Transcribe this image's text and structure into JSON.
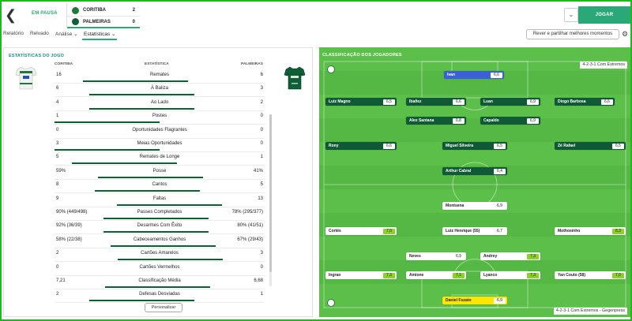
{
  "topbar": {
    "status": "EM PAUSA",
    "home": {
      "name": "CORITIBA",
      "goals": "2"
    },
    "away": {
      "name": "PALMEIRAS",
      "goals": "0"
    },
    "play_label": "JOGAR",
    "dropdown_icon": "chevron-down-icon"
  },
  "nav": {
    "items": [
      "Relatório",
      "Relvado",
      "Análise ⌄",
      "Estatísticas ⌄"
    ],
    "active_index": 3,
    "share_label": "Rever e partilhar melhores momentos",
    "settings_icon": "gear-icon"
  },
  "stats": {
    "title": "ESTATÍSTICAS DO JOGO",
    "col_home": "CORITIBA",
    "col_stat": "ESTATÍSTICA",
    "col_away": "PALMEIRAS",
    "personalize_label": "Personalizar",
    "bar_color": "#0e5e36",
    "rows": [
      {
        "home": "16",
        "name": "Remates",
        "away": "6",
        "hv": 16,
        "av": 6
      },
      {
        "home": "6",
        "name": "À Baliza",
        "away": "3",
        "hv": 6,
        "av": 3
      },
      {
        "home": "4",
        "name": "Ao Lado",
        "away": "2",
        "hv": 4,
        "av": 2
      },
      {
        "home": "1",
        "name": "Postes",
        "away": "0",
        "hv": 1,
        "av": 0
      },
      {
        "home": "0",
        "name": "Oportunidades Flagrantes",
        "away": "0",
        "hv": 0,
        "av": 0
      },
      {
        "home": "3",
        "name": "Meias Oportunidades",
        "away": "0",
        "hv": 3,
        "av": 0
      },
      {
        "home": "5",
        "name": "Remates de Longe",
        "away": "1",
        "hv": 5,
        "av": 1
      },
      {
        "home": "59%",
        "name": "Posse",
        "away": "41%",
        "hv": 59,
        "av": 41
      },
      {
        "home": "8",
        "name": "Cantos",
        "away": "5",
        "hv": 8,
        "av": 5
      },
      {
        "home": "9",
        "name": "Faltas",
        "away": "13",
        "hv": 9,
        "av": 13
      },
      {
        "home": "90% (449/498)",
        "name": "Passes Completados",
        "away": "78% (295/377)",
        "hv": 90,
        "av": 78
      },
      {
        "home": "92% (36/39)",
        "name": "Desarmes Com Êxito",
        "away": "80% (41/51)",
        "hv": 92,
        "av": 80
      },
      {
        "home": "58% (22/38)",
        "name": "Cabeceamentos Ganhos",
        "away": "67% (29/43)",
        "hv": 58,
        "av": 67
      },
      {
        "home": "2",
        "name": "Cartões Amarelos",
        "away": "3",
        "hv": 2,
        "av": 3
      },
      {
        "home": "0",
        "name": "Cartões Vermelhos",
        "away": "0",
        "hv": 0,
        "av": 0
      },
      {
        "home": "7,21",
        "name": "Classificação Média",
        "away": "6,68",
        "hv": 7.21,
        "av": 6.68
      },
      {
        "home": "2",
        "name": "Defesas Desviadas",
        "away": "1",
        "hv": 2,
        "av": 1
      }
    ]
  },
  "pitch": {
    "title": "CLASSIFICAÇÃO DOS JOGADORES",
    "formation_top": "4-2-3-1 Com Extremos",
    "formation_bottom": "4-2-3-1 Com Extremos - Gegenpress",
    "home_players": [
      {
        "name": "Ivan",
        "rating": "6,6",
        "gk": true
      },
      {
        "name": "Luiz Magno",
        "rating": "6,5"
      },
      {
        "name": "Ibañez",
        "rating": "6,6"
      },
      {
        "name": "Luan",
        "rating": "6,9"
      },
      {
        "name": "Diogo Barbosa",
        "rating": "6,6"
      },
      {
        "name": "Alex Santana",
        "rating": "6,8"
      },
      {
        "name": "Capaldo",
        "rating": "6,9"
      },
      {
        "name": "Rony",
        "rating": "6,6"
      },
      {
        "name": "Miguel Silveira",
        "rating": "6,5"
      },
      {
        "name": "Zé Rafael",
        "rating": "6,5"
      },
      {
        "name": "Arthur Cabral",
        "rating": "6,4"
      }
    ],
    "away_players": [
      {
        "name": "Montsena",
        "rating": "6,9"
      },
      {
        "name": "Cortés",
        "rating": "7,0",
        "good": true
      },
      {
        "name": "Luiz Henrique (55)",
        "rating": "6,7"
      },
      {
        "name": "Mothosinho",
        "rating": "8,3",
        "good": true
      },
      {
        "name": "Neves",
        "rating": "6,9"
      },
      {
        "name": "Andrey",
        "rating": "7,3",
        "good": true
      },
      {
        "name": "Ingrao",
        "rating": "7,3",
        "good": true
      },
      {
        "name": "Amione",
        "rating": "7,1",
        "good": true
      },
      {
        "name": "Lyanco",
        "rating": "7,3",
        "good": true
      },
      {
        "name": "Yan Couto (58)",
        "rating": "7,0",
        "good": true
      },
      {
        "name": "Daniel Fuzato",
        "rating": "6,9",
        "gk": true
      }
    ]
  }
}
